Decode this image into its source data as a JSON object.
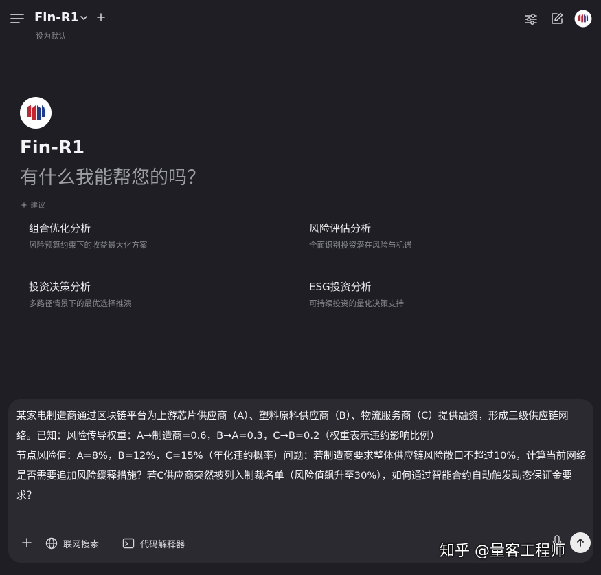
{
  "header": {
    "model_name": "Fin-R1",
    "set_default": "设为默认"
  },
  "hero": {
    "name": "Fin-R1",
    "subtitle": "有什么我能帮您的吗？"
  },
  "suggestions": {
    "label": "建议",
    "items": [
      {
        "title": "组合优化分析",
        "desc": "风险预算约束下的收益最大化方案"
      },
      {
        "title": "风险评估分析",
        "desc": "全面识别投资潜在风险与机遇"
      },
      {
        "title": "投资决策分析",
        "desc": "多路径情景下的最优选择推演"
      },
      {
        "title": "ESG投资分析",
        "desc": "可持续投资的量化决策支持"
      }
    ]
  },
  "composer": {
    "prompt": "某家电制造商通过区块链平台为上游芯片供应商（A）、塑料原料供应商（B）、物流服务商（C）提供融资，形成三级供应链网络。已知：风险传导权重：A→制造商=0.6，B→A=0.3，C→B=0.2（权重表示违约影响比例）\n节点风险值：A=8%，B=12%，C=15%（年化违约概率）问题：若制造商要求整体供应链风险敞口不超过10%，计算当前网络是否需要追加风险缓释措施？若C供应商突然被列入制裁名单（风险值飙升至30%），如何通过智能合约自动触发动态保证金要求？",
    "web_search": "联网搜索",
    "code_interpreter": "代码解释器"
  },
  "watermark": "知乎 @量客工程师",
  "colors": {
    "background": "#1f1e24",
    "composer_bg": "#2a2a30",
    "logo_red": "#c8242f",
    "logo_blue": "#1f3c8c"
  }
}
